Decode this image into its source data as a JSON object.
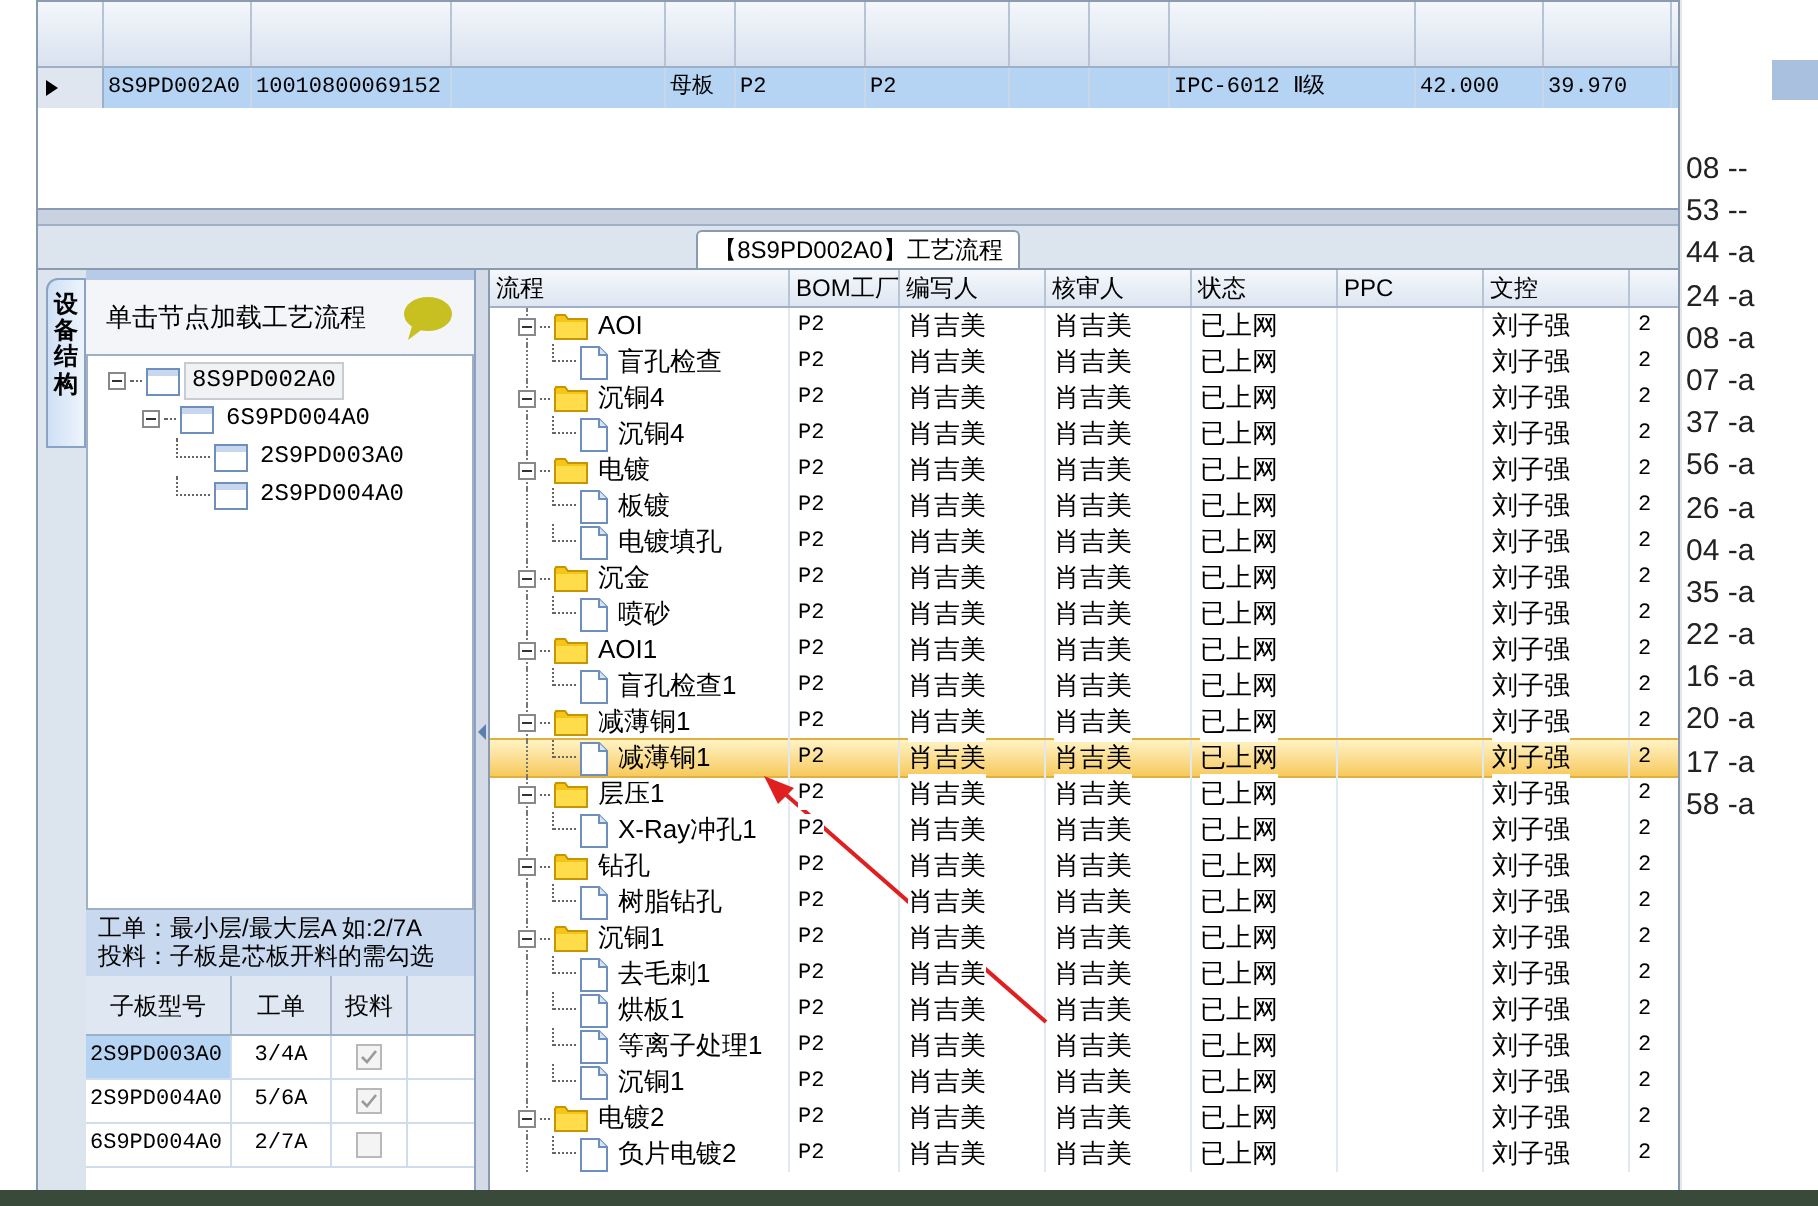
{
  "top_grid": {
    "rows": [
      {
        "selected": true,
        "column_1": "8S9PD002A0",
        "column_2": "10010800069152",
        "column_4": "母板",
        "column_5": "P2",
        "column_6": "P2",
        "column_9": "IPC-6012 Ⅱ级",
        "column_10": "42.000",
        "column_11": "39.970"
      }
    ]
  },
  "flow_tab": {
    "title": "【8S9PD002A0】工艺流程"
  },
  "side_tab": {
    "label": "设备结构"
  },
  "structure_panel": {
    "hint": "单击节点加载工艺流程",
    "tree": [
      {
        "label": "8S9PD002A0",
        "selected": true,
        "expanded": true,
        "children": [
          {
            "label": "6S9PD004A0",
            "selected": false,
            "expanded": true,
            "children": [
              {
                "label": "2S9PD003A0",
                "selected": false
              },
              {
                "label": "2S9PD004A0",
                "selected": false
              }
            ]
          }
        ]
      }
    ],
    "notes": [
      "工单：最小层/最大层A 如:2/7A",
      "投料：子板是芯板开料的需勾选"
    ],
    "sub_boards": {
      "columns": [
        "子板型号",
        "工单",
        "投料"
      ],
      "rows": [
        {
          "model": "2S9PD003A0",
          "order": "3/4A",
          "feed": true,
          "selected": true
        },
        {
          "model": "2S9PD004A0",
          "order": "5/6A",
          "feed": true,
          "selected": false
        },
        {
          "model": "6S9PD004A0",
          "order": "2/7A",
          "feed": false,
          "selected": false
        }
      ]
    }
  },
  "flow_grid": {
    "columns": [
      "流程",
      "BOM工厂",
      "编写人",
      "核审人",
      "状态",
      "PPC",
      "文控"
    ],
    "rows": [
      {
        "kind": "folder",
        "name": "AOI",
        "selected": false,
        "expanded": true,
        "bom": "P2",
        "author": "肖吉美",
        "reviewer": "肖吉美",
        "status": "已上网",
        "doc_control": "刘子强",
        "column_8": "2",
        "children": [
          {
            "kind": "step",
            "name": "盲孔检查",
            "selected": false,
            "bom": "P2",
            "author": "肖吉美",
            "reviewer": "肖吉美",
            "status": "已上网",
            "doc_control": "刘子强",
            "column_8": "2"
          }
        ]
      },
      {
        "kind": "folder",
        "name": "沉铜4",
        "selected": false,
        "expanded": true,
        "bom": "P2",
        "author": "肖吉美",
        "reviewer": "肖吉美",
        "status": "已上网",
        "doc_control": "刘子强",
        "column_8": "2",
        "children": [
          {
            "kind": "step",
            "name": "沉铜4",
            "selected": false,
            "bom": "P2",
            "author": "肖吉美",
            "reviewer": "肖吉美",
            "status": "已上网",
            "doc_control": "刘子强",
            "column_8": "2"
          }
        ]
      },
      {
        "kind": "folder",
        "name": "电镀",
        "selected": false,
        "expanded": true,
        "bom": "P2",
        "author": "肖吉美",
        "reviewer": "肖吉美",
        "status": "已上网",
        "doc_control": "刘子强",
        "column_8": "2",
        "children": [
          {
            "kind": "step",
            "name": "板镀",
            "selected": false,
            "bom": "P2",
            "author": "肖吉美",
            "reviewer": "肖吉美",
            "status": "已上网",
            "doc_control": "刘子强",
            "column_8": "2"
          },
          {
            "kind": "step",
            "name": "电镀填孔",
            "selected": false,
            "bom": "P2",
            "author": "肖吉美",
            "reviewer": "肖吉美",
            "status": "已上网",
            "doc_control": "刘子强",
            "column_8": "2"
          }
        ]
      },
      {
        "kind": "folder",
        "name": "沉金",
        "selected": false,
        "expanded": true,
        "bom": "P2",
        "author": "肖吉美",
        "reviewer": "肖吉美",
        "status": "已上网",
        "doc_control": "刘子强",
        "column_8": "2",
        "children": [
          {
            "kind": "step",
            "name": "喷砂",
            "selected": false,
            "bom": "P2",
            "author": "肖吉美",
            "reviewer": "肖吉美",
            "status": "已上网",
            "doc_control": "刘子强",
            "column_8": "2"
          }
        ]
      },
      {
        "kind": "folder",
        "name": "AOI1",
        "selected": false,
        "expanded": true,
        "bom": "P2",
        "author": "肖吉美",
        "reviewer": "肖吉美",
        "status": "已上网",
        "doc_control": "刘子强",
        "column_8": "2",
        "children": [
          {
            "kind": "step",
            "name": "盲孔检查1",
            "selected": false,
            "bom": "P2",
            "author": "肖吉美",
            "reviewer": "肖吉美",
            "status": "已上网",
            "doc_control": "刘子强",
            "column_8": "2"
          }
        ]
      },
      {
        "kind": "folder",
        "name": "减薄铜1",
        "selected": false,
        "expanded": true,
        "bom": "P2",
        "author": "肖吉美",
        "reviewer": "肖吉美",
        "status": "已上网",
        "doc_control": "刘子强",
        "column_8": "2",
        "children": [
          {
            "kind": "step",
            "name": "减薄铜1",
            "selected": true,
            "bom": "P2",
            "author": "肖吉美",
            "reviewer": "肖吉美",
            "status": "已上网",
            "doc_control": "刘子强",
            "column_8": "2"
          }
        ]
      },
      {
        "kind": "folder",
        "name": "层压1",
        "selected": false,
        "expanded": true,
        "bom": "P2",
        "author": "肖吉美",
        "reviewer": "肖吉美",
        "status": "已上网",
        "doc_control": "刘子强",
        "column_8": "2",
        "children": [
          {
            "kind": "step",
            "name": "X-Ray冲孔1",
            "selected": false,
            "bom": "P2",
            "author": "肖吉美",
            "reviewer": "肖吉美",
            "status": "已上网",
            "doc_control": "刘子强",
            "column_8": "2"
          }
        ]
      },
      {
        "kind": "folder",
        "name": "钻孔",
        "selected": false,
        "expanded": true,
        "bom": "P2",
        "author": "肖吉美",
        "reviewer": "肖吉美",
        "status": "已上网",
        "doc_control": "刘子强",
        "column_8": "2",
        "children": [
          {
            "kind": "step",
            "name": "树脂钻孔",
            "selected": false,
            "bom": "P2",
            "author": "肖吉美",
            "reviewer": "肖吉美",
            "status": "已上网",
            "doc_control": "刘子强",
            "column_8": "2"
          }
        ]
      },
      {
        "kind": "folder",
        "name": "沉铜1",
        "selected": false,
        "expanded": true,
        "bom": "P2",
        "author": "肖吉美",
        "reviewer": "肖吉美",
        "status": "已上网",
        "doc_control": "刘子强",
        "column_8": "2",
        "children": [
          {
            "kind": "step",
            "name": "去毛刺1",
            "selected": false,
            "bom": "P2",
            "author": "肖吉美",
            "reviewer": "肖吉美",
            "status": "已上网",
            "doc_control": "刘子强",
            "column_8": "2"
          },
          {
            "kind": "step",
            "name": "烘板1",
            "selected": false,
            "bom": "P2",
            "author": "肖吉美",
            "reviewer": "肖吉美",
            "status": "已上网",
            "doc_control": "刘子强",
            "column_8": "2"
          },
          {
            "kind": "step",
            "name": "等离子处理1",
            "selected": false,
            "bom": "P2",
            "author": "肖吉美",
            "reviewer": "肖吉美",
            "status": "已上网",
            "doc_control": "刘子强",
            "column_8": "2"
          },
          {
            "kind": "step",
            "name": "沉铜1",
            "selected": false,
            "bom": "P2",
            "author": "肖吉美",
            "reviewer": "肖吉美",
            "status": "已上网",
            "doc_control": "刘子强",
            "column_8": "2"
          }
        ]
      },
      {
        "kind": "folder",
        "name": "电镀2",
        "selected": false,
        "expanded": true,
        "bom": "P2",
        "author": "肖吉美",
        "reviewer": "肖吉美",
        "status": "已上网",
        "doc_control": "刘子强",
        "column_8": "2",
        "children": [
          {
            "kind": "step",
            "name": "负片电镀2",
            "selected": false,
            "bom": "P2",
            "author": "肖吉美",
            "reviewer": "肖吉美",
            "status": "已上网",
            "doc_control": "刘子强",
            "column_8": "2"
          }
        ]
      }
    ]
  },
  "background_window": {
    "rows": [
      "08 --",
      "53 --",
      "44 -a",
      "24 -a",
      "08 -a",
      "07 -a",
      "37 -a",
      "56 -a",
      "26 -a",
      "04 -a",
      "35 -a",
      "22 -a",
      "16 -a",
      "20 -a",
      "17 -a",
      "58 -a"
    ]
  }
}
